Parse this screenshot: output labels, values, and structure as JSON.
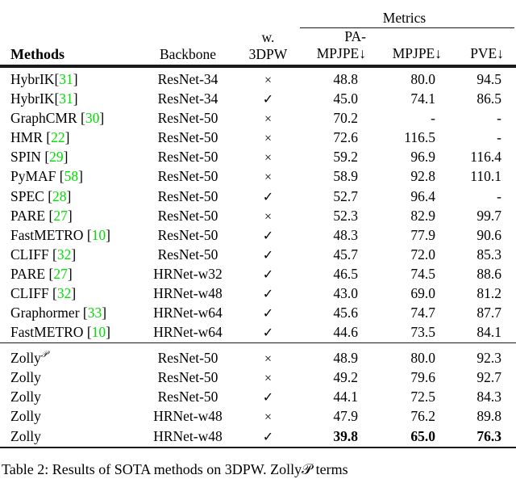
{
  "table": {
    "header": {
      "methods": "Methods",
      "backbone": "Backbone",
      "with_3dpw": "w. 3DPW",
      "metrics_group": "Metrics",
      "metric_pa_mpjpe": "PA-MPJPE↓",
      "metric_mpjpe": "MPJPE↓",
      "metric_pve": "PVE↓"
    },
    "citation_color": "#00e000",
    "marks": {
      "check": "✓",
      "cross": "×",
      "missing": "-"
    },
    "groups": [
      {
        "name": "prior-work",
        "rows": [
          {
            "method": "HybrIK",
            "cite": "31",
            "cite_space": false,
            "backbone": "ResNet-34",
            "w3dpw": "×",
            "pa_mpjpe": "48.8",
            "mpjpe": "80.0",
            "pve": "94.5",
            "best": false
          },
          {
            "method": "HybrIK",
            "cite": "31",
            "cite_space": false,
            "backbone": "ResNet-34",
            "w3dpw": "✓",
            "pa_mpjpe": "45.0",
            "mpjpe": "74.1",
            "pve": "86.5",
            "best": false
          },
          {
            "method": "GraphCMR",
            "cite": "30",
            "cite_space": true,
            "backbone": "ResNet-50",
            "w3dpw": "×",
            "pa_mpjpe": "70.2",
            "mpjpe": "-",
            "pve": "-",
            "best": false
          },
          {
            "method": "HMR",
            "cite": "22",
            "cite_space": true,
            "backbone": "ResNet-50",
            "w3dpw": "×",
            "pa_mpjpe": "72.6",
            "mpjpe": "116.5",
            "pve": "-",
            "best": false
          },
          {
            "method": "SPIN",
            "cite": "29",
            "cite_space": true,
            "backbone": "ResNet-50",
            "w3dpw": "×",
            "pa_mpjpe": "59.2",
            "mpjpe": "96.9",
            "pve": "116.4",
            "best": false
          },
          {
            "method": "PyMAF",
            "cite": "58",
            "cite_space": true,
            "backbone": "ResNet-50",
            "w3dpw": "×",
            "pa_mpjpe": "58.9",
            "mpjpe": "92.8",
            "pve": "110.1",
            "best": false
          },
          {
            "method": "SPEC",
            "cite": "28",
            "cite_space": true,
            "backbone": "ResNet-50",
            "w3dpw": "✓",
            "pa_mpjpe": "52.7",
            "mpjpe": "96.4",
            "pve": "-",
            "best": false
          },
          {
            "method": "PARE",
            "cite": "27",
            "cite_space": true,
            "backbone": "ResNet-50",
            "w3dpw": "×",
            "pa_mpjpe": "52.3",
            "mpjpe": "82.9",
            "pve": "99.7",
            "best": false
          },
          {
            "method": "FastMETRO",
            "cite": "10",
            "cite_space": true,
            "backbone": "ResNet-50",
            "w3dpw": "✓",
            "pa_mpjpe": "48.3",
            "mpjpe": "77.9",
            "pve": "90.6",
            "best": false
          },
          {
            "method": "CLIFF",
            "cite": "32",
            "cite_space": true,
            "backbone": "ResNet-50",
            "w3dpw": "✓",
            "pa_mpjpe": "45.7",
            "mpjpe": "72.0",
            "pve": "85.3",
            "best": false
          },
          {
            "method": "PARE",
            "cite": "27",
            "cite_space": true,
            "backbone": "HRNet-w32",
            "w3dpw": "✓",
            "pa_mpjpe": "46.5",
            "mpjpe": "74.5",
            "pve": "88.6",
            "best": false
          },
          {
            "method": "CLIFF",
            "cite": "32",
            "cite_space": true,
            "backbone": "HRNet-w48",
            "w3dpw": "✓",
            "pa_mpjpe": "43.0",
            "mpjpe": "69.0",
            "pve": "81.2",
            "best": false
          },
          {
            "method": "Graphormer",
            "cite": "33",
            "cite_space": true,
            "backbone": "HRNet-w64",
            "w3dpw": "✓",
            "pa_mpjpe": "45.6",
            "mpjpe": "74.7",
            "pve": "87.7",
            "best": false
          },
          {
            "method": "FastMETRO",
            "cite": "10",
            "cite_space": true,
            "backbone": "HRNet-w64",
            "w3dpw": "✓",
            "pa_mpjpe": "44.6",
            "mpjpe": "73.5",
            "pve": "84.1",
            "best": false
          }
        ]
      },
      {
        "name": "ours-zolly",
        "rows": [
          {
            "method": "Zolly",
            "cite": null,
            "sup": "𝒫",
            "backbone": "ResNet-50",
            "w3dpw": "×",
            "pa_mpjpe": "48.9",
            "mpjpe": "80.0",
            "pve": "92.3",
            "best": false
          },
          {
            "method": "Zolly",
            "cite": null,
            "sup": null,
            "backbone": "ResNet-50",
            "w3dpw": "×",
            "pa_mpjpe": "49.2",
            "mpjpe": "79.6",
            "pve": "92.7",
            "best": false
          },
          {
            "method": "Zolly",
            "cite": null,
            "sup": null,
            "backbone": "ResNet-50",
            "w3dpw": "✓",
            "pa_mpjpe": "44.1",
            "mpjpe": "72.5",
            "pve": "84.3",
            "best": false
          },
          {
            "method": "Zolly",
            "cite": null,
            "sup": null,
            "backbone": "HRNet-w48",
            "w3dpw": "×",
            "pa_mpjpe": "47.9",
            "mpjpe": "76.2",
            "pve": "89.8",
            "best": false
          },
          {
            "method": "Zolly",
            "cite": null,
            "sup": null,
            "backbone": "HRNet-w48",
            "w3dpw": "✓",
            "pa_mpjpe": "39.8",
            "mpjpe": "65.0",
            "pve": "76.3",
            "best": true
          }
        ]
      }
    ]
  },
  "caption": {
    "label": "Table 2:",
    "text": "Results of SOTA methods on 3DPW. Zolly𝒫 terms"
  }
}
